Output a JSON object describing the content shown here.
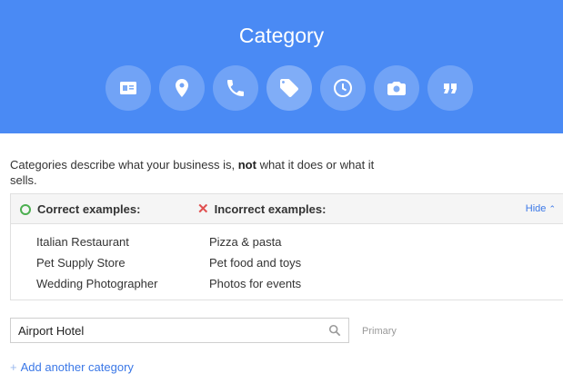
{
  "header": {
    "title": "Category",
    "steps": [
      {
        "icon": "contact-card-icon"
      },
      {
        "icon": "location-pin-icon"
      },
      {
        "icon": "phone-icon"
      },
      {
        "icon": "tag-icon",
        "active": true
      },
      {
        "icon": "clock-icon"
      },
      {
        "icon": "camera-icon"
      },
      {
        "icon": "quote-icon"
      }
    ]
  },
  "intro": {
    "before": "Categories describe what your business is, ",
    "bold": "not",
    "after": " what it does or what it sells."
  },
  "examples": {
    "correct_label": "Correct examples:",
    "incorrect_label": "Incorrect examples:",
    "hide_label": "Hide",
    "correct": [
      "Italian Restaurant",
      "Pet Supply Store",
      "Wedding Photographer"
    ],
    "incorrect": [
      "Pizza & pasta",
      "Pet food and toys",
      "Photos for events"
    ]
  },
  "category_input": {
    "value": "Airport Hotel",
    "primary_label": "Primary"
  },
  "add_link": {
    "label": "Add another category"
  },
  "colors": {
    "header_bg": "#4a8af4",
    "link": "#3b78e7",
    "correct": "#4caf50",
    "incorrect": "#e05050"
  }
}
